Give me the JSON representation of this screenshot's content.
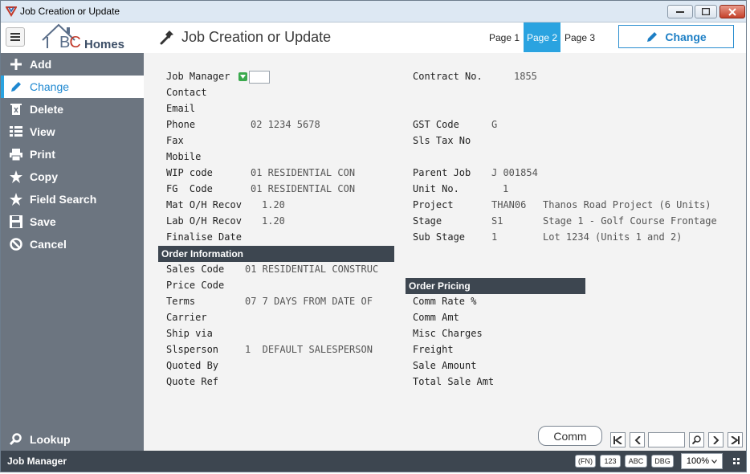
{
  "window": {
    "title": "Job Creation or Update"
  },
  "header": {
    "logo_bc": "BC",
    "logo_homes": "Homes",
    "page_title": "Job Creation or Update",
    "tabs": [
      "Page 1",
      "Page 2",
      "Page 3"
    ],
    "active_tab": "Page 2",
    "action_button": "Change"
  },
  "sidebar": {
    "items": [
      {
        "label": "Add",
        "icon": "plus-icon"
      },
      {
        "label": "Change",
        "icon": "pencil-icon"
      },
      {
        "label": "Delete",
        "icon": "trash-icon"
      },
      {
        "label": "View",
        "icon": "list-icon"
      },
      {
        "label": "Print",
        "icon": "printer-icon"
      },
      {
        "label": "Copy",
        "icon": "star-icon"
      },
      {
        "label": "Field Search",
        "icon": "star-icon"
      },
      {
        "label": "Save",
        "icon": "floppy-icon"
      },
      {
        "label": "Cancel",
        "icon": "cancel-icon"
      }
    ],
    "active": "Change",
    "lookup": "Lookup"
  },
  "form": {
    "left": [
      {
        "label": "Job Manager",
        "value": ""
      },
      {
        "label": "Contact",
        "value": ""
      },
      {
        "label": "Email",
        "value": ""
      },
      {
        "label": "Phone",
        "value": "02 1234 5678"
      },
      {
        "label": "Fax",
        "value": ""
      },
      {
        "label": "Mobile",
        "value": ""
      },
      {
        "label": "WIP code",
        "value": "01 RESIDENTIAL CON"
      },
      {
        "label": "FG  Code",
        "value": "01 RESIDENTIAL CON"
      },
      {
        "label": "Mat O/H Recov",
        "value": "1.20"
      },
      {
        "label": "Lab O/H Recov",
        "value": "1.20"
      },
      {
        "label": "Finalise Date",
        "value": ""
      }
    ],
    "right": [
      {
        "label": "Contract No.",
        "value": "1855",
        "desc": ""
      },
      {
        "label": "GST Code",
        "value": "G",
        "desc": ""
      },
      {
        "label": "Sls Tax No",
        "value": "",
        "desc": ""
      },
      {
        "label": "Parent Job",
        "value": "J 001854",
        "desc": ""
      },
      {
        "label": "Unit No.",
        "value": "1",
        "desc": ""
      },
      {
        "label": "Project",
        "value": "THAN06",
        "desc": "Thanos Road Project (6 Units)"
      },
      {
        "label": "Stage",
        "value": "S1",
        "desc": "Stage 1 - Golf Course Frontage"
      },
      {
        "label": "Sub Stage",
        "value": "1",
        "desc": "Lot 1234 (Units 1 and 2)"
      }
    ],
    "order_information": {
      "title": "Order Information",
      "rows": [
        {
          "label": "Sales Code",
          "value": "01 RESIDENTIAL CONSTRUC"
        },
        {
          "label": "Price Code",
          "value": ""
        },
        {
          "label": "Terms",
          "value": "07 7 DAYS FROM DATE OF"
        },
        {
          "label": "Carrier",
          "value": ""
        },
        {
          "label": "Ship via",
          "value": ""
        },
        {
          "label": "Slsperson",
          "value": "1  DEFAULT SALESPERSON"
        },
        {
          "label": "Quoted By",
          "value": ""
        },
        {
          "label": "Quote Ref",
          "value": ""
        }
      ]
    },
    "order_pricing": {
      "title": "Order Pricing",
      "rows": [
        "Comm Rate %",
        "Comm Amt",
        "Misc Charges",
        "Freight",
        "Sale Amount",
        "Total Sale Amt"
      ]
    }
  },
  "footer": {
    "comm_button": "Comm",
    "status": "Job Manager",
    "pills": [
      "(FN)",
      "123",
      "ABC",
      "DBG"
    ],
    "zoom": "100%"
  },
  "colors": {
    "accent": "#2aa3e0",
    "sidebar": "#6c7580",
    "dark": "#3d4650"
  }
}
